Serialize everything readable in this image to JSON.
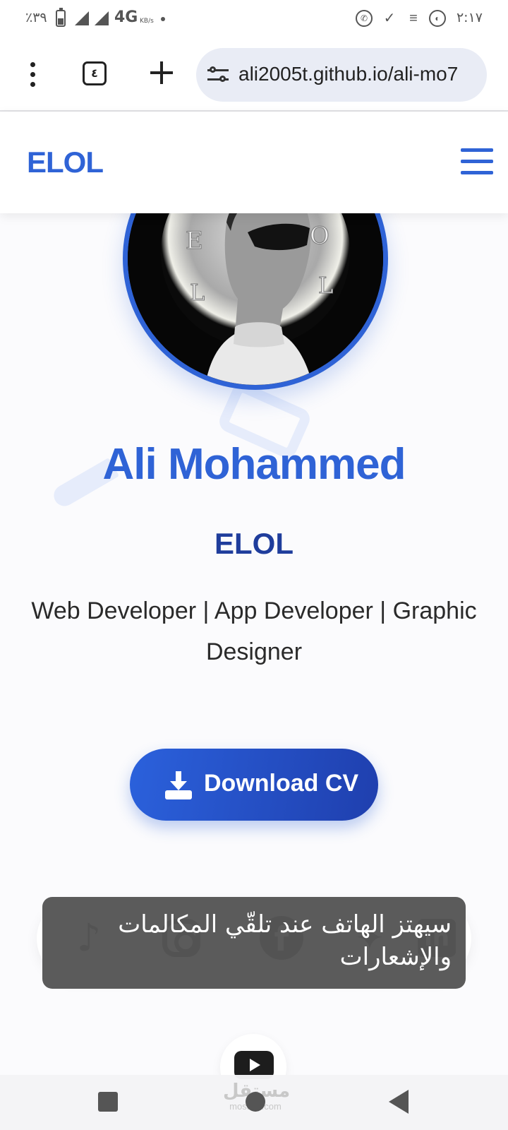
{
  "status_bar": {
    "battery_percent": "٪٣٩",
    "network": "4G",
    "speed_unit": "KB/s",
    "time": "٢:١٧",
    "icons": [
      "battery-icon",
      "signal-icon",
      "signal-icon",
      "whatsapp-icon",
      "check-icon",
      "storage-warning-icon",
      "globe-icon"
    ]
  },
  "browser": {
    "tab_count": "٤",
    "url": "ali2005t.github.io/ali-mo7",
    "icons": [
      "more-vert-icon",
      "tabs-icon",
      "plus-icon",
      "tune-icon"
    ]
  },
  "site": {
    "logo": "ELOL",
    "menu_icon": "hamburger-icon"
  },
  "hero": {
    "name": "Ali Mohammed",
    "brand": "ELOL",
    "roles": "Web Developer | App Developer | Graphic Designer",
    "download_label": "Download CV",
    "download_icon": "download-icon"
  },
  "social": {
    "icons": [
      "tiktok-icon",
      "instagram-icon",
      "facebook-icon",
      "twitter-icon",
      "linkedin-icon",
      "youtube-icon"
    ]
  },
  "toast": {
    "message": "سيهتز الهاتف عند تلقّي المكالمات والإشعارات"
  },
  "watermark": {
    "arabic": "مستقل",
    "latin": "mostaql.com"
  },
  "colors": {
    "accent": "#2f63d6",
    "accent_dark": "#1f3d9c",
    "toast_bg": "#545454"
  }
}
